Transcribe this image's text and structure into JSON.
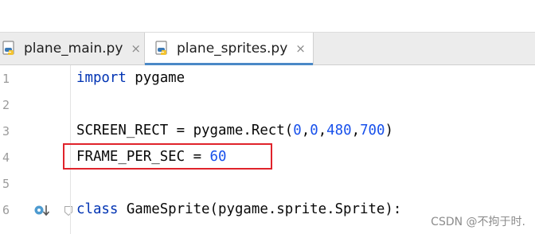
{
  "tabs": [
    {
      "label": "plane_main.py",
      "active": false,
      "icon": "python-file-icon"
    },
    {
      "label": "plane_sprites.py",
      "active": true,
      "icon": "python-file-icon"
    }
  ],
  "close_glyph": "×",
  "editor": {
    "line_numbers": [
      "1",
      "2",
      "3",
      "4",
      "5",
      "6"
    ],
    "lines": [
      {
        "segments": [
          {
            "text": "import",
            "kind": "kw"
          },
          {
            "text": " pygame",
            "kind": "plain"
          }
        ]
      },
      {
        "segments": []
      },
      {
        "segments": [
          {
            "text": "SCREEN_RECT = pygame.Rect(",
            "kind": "plain"
          },
          {
            "text": "0",
            "kind": "num"
          },
          {
            "text": ",",
            "kind": "plain"
          },
          {
            "text": "0",
            "kind": "num"
          },
          {
            "text": ",",
            "kind": "plain"
          },
          {
            "text": "480",
            "kind": "num"
          },
          {
            "text": ",",
            "kind": "plain"
          },
          {
            "text": "700",
            "kind": "num"
          },
          {
            "text": ")",
            "kind": "plain"
          }
        ]
      },
      {
        "segments": [
          {
            "text": "FRAME_PER_SEC = ",
            "kind": "plain"
          },
          {
            "text": "60",
            "kind": "num"
          }
        ]
      },
      {
        "segments": []
      },
      {
        "segments": [
          {
            "text": "class",
            "kind": "kw"
          },
          {
            "text": " GameSprite(pygame.sprite.Sprite):",
            "kind": "plain"
          }
        ]
      }
    ]
  },
  "watermark": "CSDN @不拘于时.",
  "colors": {
    "keyword": "#0033b3",
    "number": "#1750eb",
    "highlight_border": "#e0232b",
    "tab_underline": "#4a88c7"
  }
}
